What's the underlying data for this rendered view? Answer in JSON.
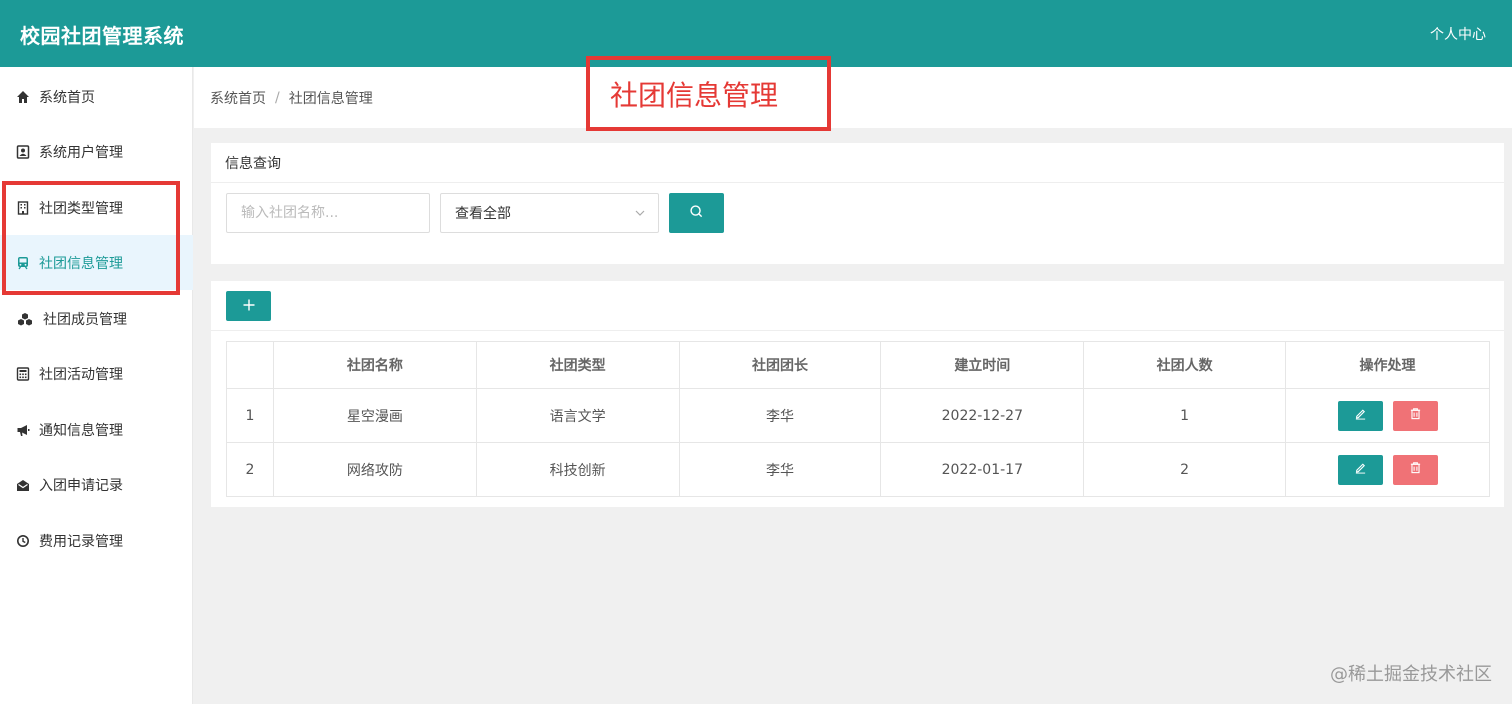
{
  "header": {
    "title": "校园社团管理系统",
    "user_center": "个人中心"
  },
  "sidebar": {
    "items": [
      {
        "label": "系统首页",
        "icon": "home-icon"
      },
      {
        "label": "系统用户管理",
        "icon": "user-card-icon"
      },
      {
        "label": "社团类型管理",
        "icon": "building-icon"
      },
      {
        "label": "社团信息管理",
        "icon": "train-icon",
        "active": true
      },
      {
        "label": "社团成员管理",
        "icon": "cubes-icon"
      },
      {
        "label": "社团活动管理",
        "icon": "calculator-icon"
      },
      {
        "label": "通知信息管理",
        "icon": "bullhorn-icon"
      },
      {
        "label": "入团申请记录",
        "icon": "envelope-open-icon"
      },
      {
        "label": "费用记录管理",
        "icon": "clock-icon"
      }
    ]
  },
  "breadcrumb": {
    "home": "系统首页",
    "separator": "/",
    "current": "社团信息管理"
  },
  "annotation": {
    "text": "社团信息管理",
    "color": "#e53935"
  },
  "query": {
    "title": "信息查询",
    "search_placeholder": "输入社团名称...",
    "select_value": "查看全部"
  },
  "table": {
    "headers": [
      "",
      "社团名称",
      "社团类型",
      "社团团长",
      "建立时间",
      "社团人数",
      "操作处理"
    ],
    "rows": [
      {
        "index": "1",
        "name": "星空漫画",
        "type": "语言文学",
        "leader": "李华",
        "date": "2022-12-27",
        "count": "1"
      },
      {
        "index": "2",
        "name": "网络攻防",
        "type": "科技创新",
        "leader": "李华",
        "date": "2022-01-17",
        "count": "2"
      }
    ]
  },
  "watermark": "@稀土掘金技术社区",
  "colors": {
    "primary": "#1c9a97",
    "danger": "#f07276",
    "active_bg": "#e9f5fd"
  }
}
